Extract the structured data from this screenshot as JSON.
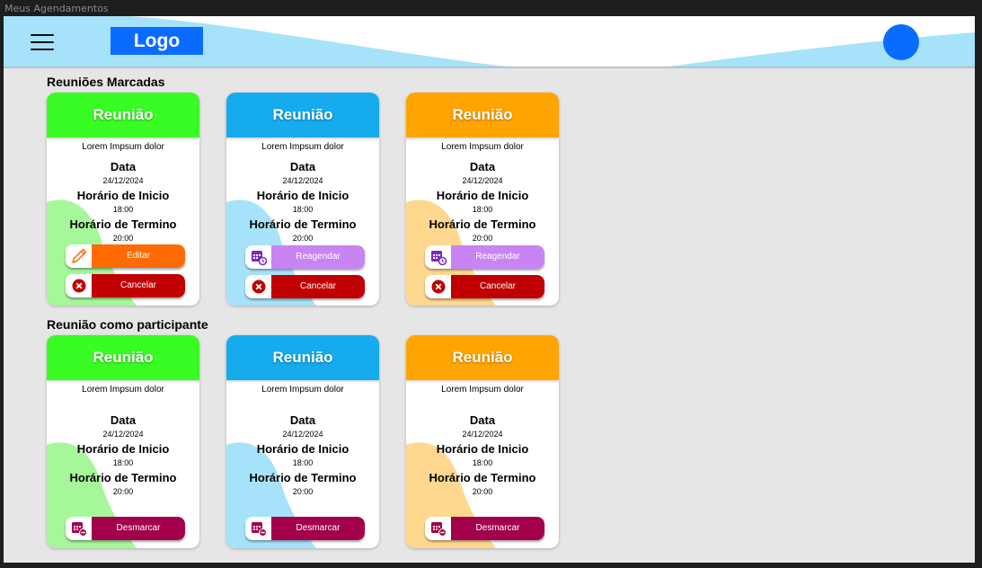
{
  "window": {
    "title": "Meus Agendamentos"
  },
  "header": {
    "logo": "Logo"
  },
  "colors": {
    "green": "#38fc24",
    "blue": "#15abec",
    "orange": "#ffa400",
    "editar": "#ff6b00",
    "cancelar": "#c00000",
    "reagendar": "#c884f2",
    "desmarcar": "#a3004b"
  },
  "sections": {
    "marcadas": {
      "title": "Reuniões Marcadas",
      "cards": [
        {
          "title": "Reunião",
          "desc": "Lorem Impsum dolor",
          "data_label": "Data",
          "data": "24/12/2024",
          "inicio_label": "Horário de Inicio",
          "inicio": "18:00",
          "termino_label": "Horário de Termino",
          "termino": "20:00",
          "primary": "Editar",
          "secondary": "Cancelar"
        },
        {
          "title": "Reunião",
          "desc": "Lorem Impsum dolor",
          "data_label": "Data",
          "data": "24/12/2024",
          "inicio_label": "Horário de Inicio",
          "inicio": "18:00",
          "termino_label": "Horário de Termino",
          "termino": "20:00",
          "primary": "Reagendar",
          "secondary": "Cancelar"
        },
        {
          "title": "Reunião",
          "desc": "Lorem Impsum dolor",
          "data_label": "Data",
          "data": "24/12/2024",
          "inicio_label": "Horário de Inicio",
          "inicio": "18:00",
          "termino_label": "Horário de Termino",
          "termino": "20:00",
          "primary": "Reagendar",
          "secondary": "Cancelar"
        }
      ]
    },
    "participante": {
      "title": "Reunião como participante",
      "cards": [
        {
          "title": "Reunião",
          "desc": "Lorem Impsum dolor",
          "data_label": "Data",
          "data": "24/12/2024",
          "inicio_label": "Horário de Inicio",
          "inicio": "18:00",
          "termino_label": "Horário de Termino",
          "termino": "20:00",
          "action": "Desmarcar"
        },
        {
          "title": "Reunião",
          "desc": "Lorem Impsum dolor",
          "data_label": "Data",
          "data": "24/12/2024",
          "inicio_label": "Horário de Inicio",
          "inicio": "18:00",
          "termino_label": "Horário de Termino",
          "termino": "20:00",
          "action": "Desmarcar"
        },
        {
          "title": "Reunião",
          "desc": "Lorem Impsum dolor",
          "data_label": "Data",
          "data": "24/12/2024",
          "inicio_label": "Horário de Inicio",
          "inicio": "18:00",
          "termino_label": "Horário de Termino",
          "termino": "20:00",
          "action": "Desmarcar"
        }
      ]
    }
  }
}
